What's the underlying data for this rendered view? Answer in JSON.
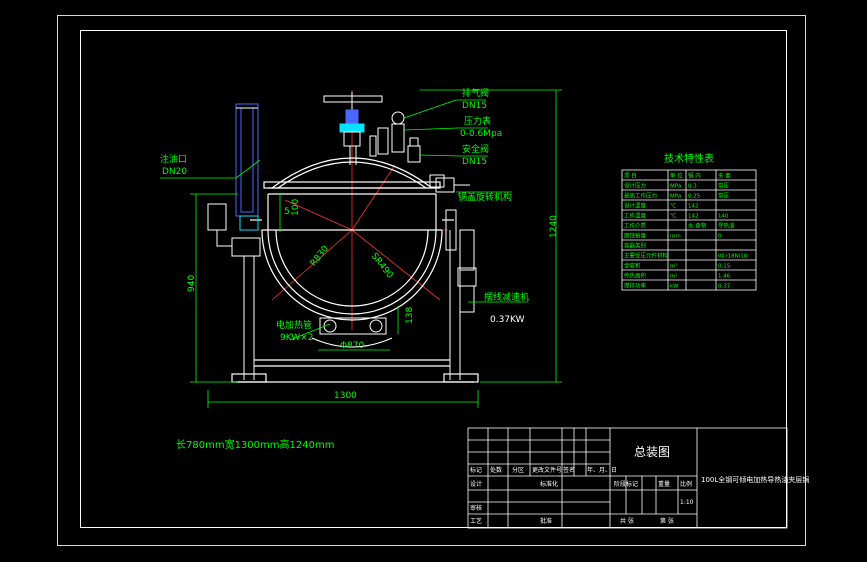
{
  "colors": {
    "background": "#000000",
    "frame": "#ffffff",
    "drawing": "#ffffff",
    "dimension": "#00ff00",
    "centerline": "#ff3030",
    "part_blue": "#4a66ff",
    "part_cyan": "#00e5ff"
  },
  "annotations": {
    "exhaust_valve": "排气阀",
    "exhaust_valve_spec": "DN15",
    "pressure_gauge": "压力表",
    "pressure_gauge_spec": "0-0.6Mpa",
    "safety_valve": "安全阀",
    "safety_valve_spec": "DN15",
    "lid_mechanism": "锅盖旋转机构",
    "inlet": "注油口",
    "inlet_spec": "DN20",
    "heater": "电加热管",
    "heater_spec": "9KW×2",
    "motor": "摆线减速机",
    "motor_spec": "0.37KW"
  },
  "dimensions": {
    "radius_left": "R830",
    "radius_right": "SR490",
    "height_left": "940",
    "height_right": "1240",
    "width_bottom": "1300",
    "dim_100": "100",
    "dim_5": "5",
    "dim_138": "138",
    "dim_870": "Φ870"
  },
  "note": "长780mm宽1300mm高1240mm",
  "tech_table": {
    "title": "技术特性表",
    "header": [
      "项 目",
      "单 位",
      "锅 内",
      "夹 套"
    ],
    "rows": [
      [
        "设计压力",
        "MPa",
        "0.3",
        "常压"
      ],
      [
        "最高工作压力",
        "MPa",
        "0.25",
        "常压"
      ],
      [
        "设计温度",
        "℃",
        "142",
        ""
      ],
      [
        "工作温度",
        "℃",
        "142",
        "140"
      ],
      [
        "工作介质",
        "",
        "水 食物",
        "导热油"
      ],
      [
        "腐蚀裕度",
        "mm",
        "",
        "0"
      ],
      [
        "容器类别",
        "",
        "",
        ""
      ],
      [
        "主要受压元件材料",
        "",
        "",
        "0Cr18Ni10"
      ],
      [
        "全容积",
        "m³",
        "",
        "0.15"
      ],
      [
        "传热面积",
        "m²",
        "",
        "1.46"
      ],
      [
        "搅拌功率",
        "kW",
        "",
        "0.37"
      ]
    ]
  },
  "title_block": {
    "drawing_name": "总装图",
    "product_name": "100L全钢可倾电加热导热油夹层锅",
    "col_labels": [
      "标记",
      "处数",
      "分区",
      "更改文件号",
      "签名",
      "年、月、日"
    ],
    "designer": "设计",
    "standardization": "标准化",
    "checker": "审核",
    "process": "工艺",
    "approval": "批准",
    "stage_mark": "阶段标记",
    "weight": "重量",
    "scale": "比例",
    "scale_value": "1:10",
    "sheet_total": "共  张",
    "sheet_no": "第  张"
  }
}
